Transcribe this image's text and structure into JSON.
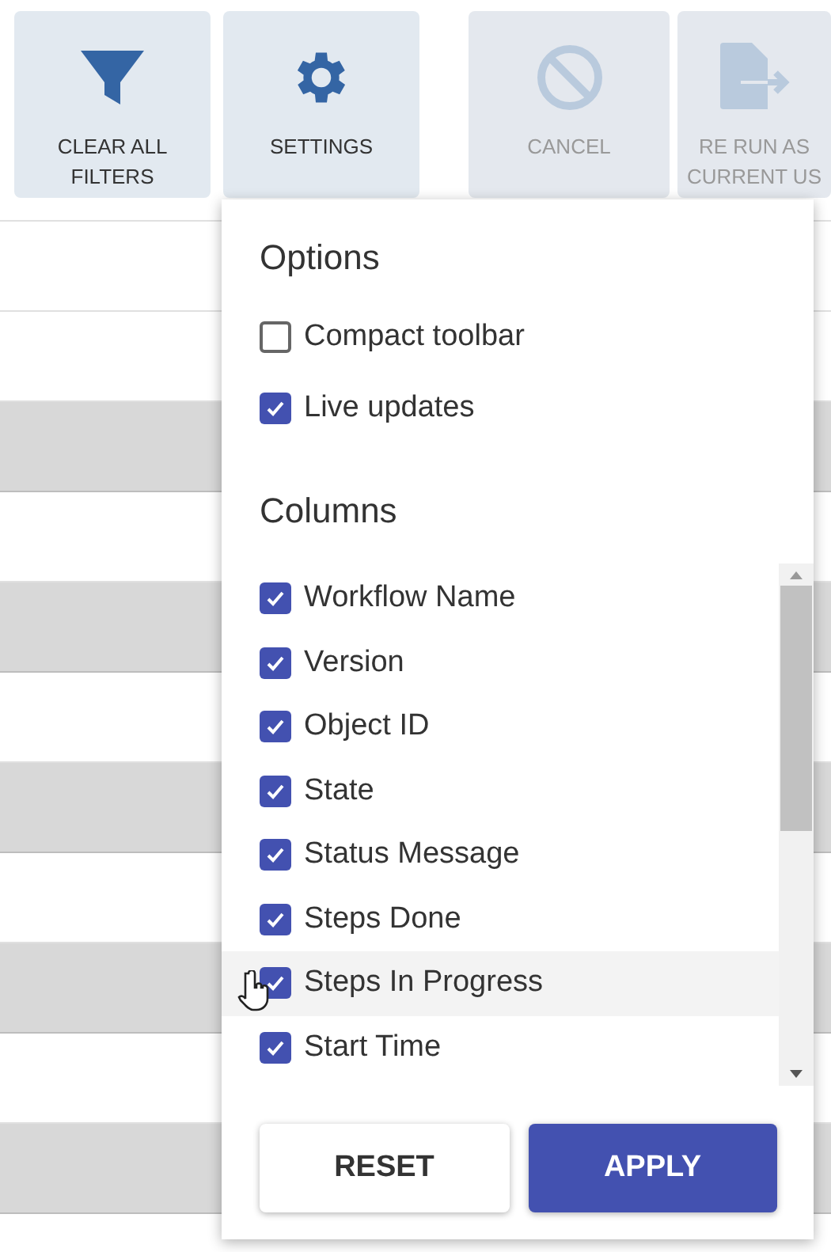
{
  "toolbar": {
    "buttons": [
      {
        "kind": "filter",
        "label": "CLEAR ALL FILTERS",
        "disabled": false
      },
      {
        "kind": "settings",
        "label": "SETTINGS",
        "disabled": false
      },
      {
        "kind": "cancel",
        "label": "CANCEL",
        "disabled": true
      },
      {
        "kind": "rerun",
        "label": "RE RUN AS\nCURRENT US",
        "disabled": true
      }
    ]
  },
  "table": {
    "rows": [
      {
        "shaded": false
      },
      {
        "shaded": false
      },
      {
        "shaded": true
      },
      {
        "shaded": false
      },
      {
        "shaded": true
      },
      {
        "shaded": false
      },
      {
        "shaded": true
      },
      {
        "shaded": false
      },
      {
        "shaded": true
      },
      {
        "shaded": false
      },
      {
        "shaded": true
      }
    ]
  },
  "settings_menu": {
    "options_heading": "Options",
    "options": [
      {
        "label": "Compact toolbar",
        "checked": false
      },
      {
        "label": "Live updates",
        "checked": true
      }
    ],
    "columns_heading": "Columns",
    "columns": [
      {
        "label": "Workflow Name",
        "checked": true,
        "hovered": false
      },
      {
        "label": "Version",
        "checked": true,
        "hovered": false
      },
      {
        "label": "Object ID",
        "checked": true,
        "hovered": false
      },
      {
        "label": "State",
        "checked": true,
        "hovered": false
      },
      {
        "label": "Status Message",
        "checked": true,
        "hovered": false
      },
      {
        "label": "Steps Done",
        "checked": true,
        "hovered": false
      },
      {
        "label": "Steps In Progress",
        "checked": true,
        "hovered": true
      },
      {
        "label": "Start Time",
        "checked": true,
        "hovered": false
      }
    ],
    "buttons": [
      {
        "kind": "secondary",
        "label": "RESET"
      },
      {
        "kind": "primary",
        "label": "APPLY"
      }
    ]
  }
}
